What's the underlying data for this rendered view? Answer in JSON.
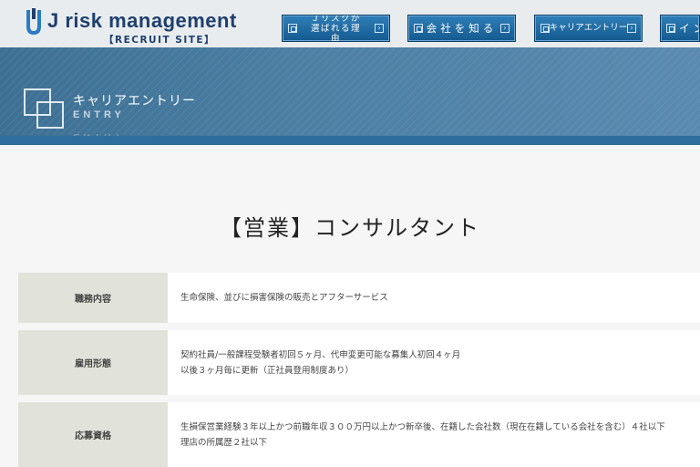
{
  "header": {
    "logo_main": "J risk management",
    "logo_sub": "【RECRUIT SITE】",
    "nav": [
      {
        "label": "Ｊリスクが選ばれる理由"
      },
      {
        "label": "会社を知る"
      },
      {
        "label": "キャリアエントリー"
      },
      {
        "label": "イン"
      }
    ]
  },
  "banner": {
    "title": "キャリアエントリー",
    "subtitle": "ENTRY"
  },
  "main": {
    "heading": "【営業】コンサルタント",
    "rows": [
      {
        "label": "職務内容",
        "lines": [
          "生命保険、並びに損害保険の販売とアフターサービス"
        ]
      },
      {
        "label": "雇用形態",
        "lines": [
          "契約社員/一般課程受験者初回５ヶ月、代申変更可能な募集人初回４ヶ月",
          "以後３ヶ月毎に更新（正社員登用制度あり）"
        ]
      },
      {
        "label": "応募資格",
        "lines": [
          "生損保営業経験３年以上かつ前職年収３００万円以上かつ新卒後、在籍した会社数（現在在籍している会社を含む）４社以下",
          "理店の所属歴２社以下"
        ]
      }
    ]
  },
  "colors": {
    "brand": "#1e3f6e",
    "nav_button": "#1f6ba3",
    "banner": "#4b7fa3",
    "row_header": "#e1e2d9"
  }
}
